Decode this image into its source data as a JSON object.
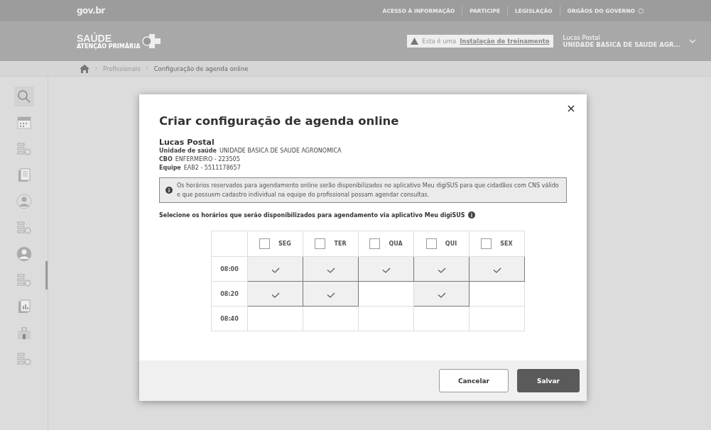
{
  "gov_bar": {
    "logo": "gov.br",
    "links": [
      {
        "label": "ACESSO À INFORMAÇÃO"
      },
      {
        "label": "PARTICIPE"
      },
      {
        "label": "LEGISLAÇÃO"
      },
      {
        "label": "ÓRGÃOS DO GOVERNO",
        "dropdown": true
      }
    ]
  },
  "header": {
    "logo": "SAÚDE",
    "logo_subtitle": "ATENÇÃO PRIMÁRIA",
    "notice": {
      "text": "Esta é uma",
      "link": "Instalação de treinamento"
    },
    "user": {
      "name": "Lucas Postal",
      "unit": "UNIDADE BASICA DE SAUDE AGR..."
    }
  },
  "breadcrumb": [
    "Profissionais",
    "Configuração de agenda online"
  ],
  "sidebar": {
    "items": [
      {
        "kind": "search"
      },
      {
        "kind": "calendar"
      },
      {
        "kind": "list-stethoscope"
      },
      {
        "kind": "document"
      },
      {
        "kind": "person"
      },
      {
        "kind": "list-gear"
      },
      {
        "kind": "doctor"
      },
      {
        "kind": "list-clock"
      },
      {
        "kind": "report"
      },
      {
        "kind": "building"
      },
      {
        "kind": "list-person"
      }
    ]
  },
  "dialog": {
    "title": "Criar configuração de agenda online",
    "professional": {
      "name": "Lucas Postal",
      "fields": [
        {
          "label": "Unidade de saúde",
          "value": "UNIDADE BASICA DE SAUDE AGRONOMICA"
        },
        {
          "label": "CBO",
          "value": "ENFERMEIRO - 223505"
        },
        {
          "label": "Equipe",
          "value": "EAB2 -  5511178657"
        }
      ]
    },
    "info": "Os horários reservados para agendamento online serão disponibilizados no aplicativo Meu digiSUS para que cidadãos com CNS válido e que possuem cadastro individual na equipe do profissional possam agendar consultas.",
    "instruction": "Selecione os horários que serão disponibilizados para agendamento via aplicativo Meu digiSUS",
    "days": [
      {
        "label": "SEG",
        "checked": false
      },
      {
        "label": "TER",
        "checked": false
      },
      {
        "label": "QUA",
        "checked": false
      },
      {
        "label": "QUI",
        "checked": false
      },
      {
        "label": "SEX",
        "checked": false
      }
    ],
    "rows": [
      {
        "time": "08:00",
        "slots": [
          {
            "selected": true
          },
          {
            "selected": true
          },
          {
            "selected": true
          },
          {
            "selected": true
          },
          {
            "selected": true
          }
        ]
      },
      {
        "time": "08:20",
        "slots": [
          {
            "selected": true
          },
          {
            "selected": true
          },
          {
            "selected": false
          },
          {
            "selected": true
          },
          {
            "selected": false
          }
        ]
      },
      {
        "time": "08:40",
        "slots": [
          {
            "selected": false
          },
          {
            "selected": false
          },
          {
            "selected": false
          },
          {
            "selected": false
          },
          {
            "selected": false
          }
        ]
      }
    ],
    "buttons": [
      {
        "label": "Cancelar",
        "kind": "secondary"
      },
      {
        "label": "Salvar",
        "kind": "primary"
      }
    ]
  }
}
